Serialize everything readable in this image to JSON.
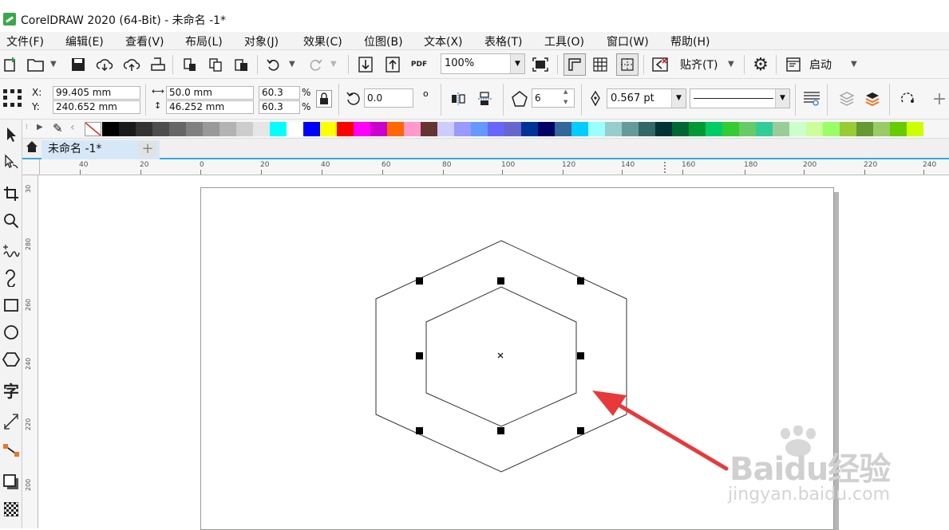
{
  "window": {
    "title": "CorelDRAW 2020 (64-Bit) - 未命名 -1*"
  },
  "menu": [
    "文件(F)",
    "编辑(E)",
    "查看(V)",
    "布局(L)",
    "对象(J)",
    "效果(C)",
    "位图(B)",
    "文本(X)",
    "表格(T)",
    "工具(O)",
    "窗口(W)",
    "帮助(H)"
  ],
  "toolbar": {
    "zoom": "100%",
    "pdf_label": "PDF",
    "snap_label": "贴齐(T)",
    "launch_label": "启动"
  },
  "props": {
    "x_label": "X:",
    "y_label": "Y:",
    "x_value": "99.405 mm",
    "y_value": "240.652 mm",
    "width_value": "50.0 mm",
    "height_value": "46.252 mm",
    "scale_x": "60.3",
    "scale_y": "60.3",
    "percent": "%",
    "rotation": "0.0",
    "degree": "o",
    "sides": "6",
    "outline_width": "0.567 pt"
  },
  "tabs": {
    "document": "未命名 -1*"
  },
  "ruler": {
    "h_ticks": [
      "40",
      "20",
      "0",
      "20",
      "40",
      "60",
      "80",
      "100",
      "120",
      "140",
      "160",
      "180",
      "200",
      "220",
      "240"
    ],
    "v_ticks": [
      "30",
      "280",
      "260",
      "240",
      "220",
      "200"
    ]
  },
  "palette": [
    "#000000",
    "#1a1a1a",
    "#333333",
    "#4d4d4d",
    "#666666",
    "#808080",
    "#999999",
    "#b3b3b3",
    "#cccccc",
    "#e6e6e6",
    "#00ffff",
    "#ffffff",
    "#0000ff",
    "#ffff00",
    "#ff0000",
    "#ff00ff",
    "#cc00cc",
    "#ff6600",
    "#ff99cc",
    "#663333",
    "#ccccff",
    "#9999ff",
    "#6699ff",
    "#6666ff",
    "#6666cc",
    "#003399",
    "#000066",
    "#336699",
    "#00ccff",
    "#99ffff",
    "#99cccc",
    "#669999",
    "#336666",
    "#003333",
    "#006633",
    "#009933",
    "#00cc66",
    "#33cc33",
    "#66cc66",
    "#33cc99",
    "#99cc99",
    "#ccffcc",
    "#ccff99",
    "#99ff66",
    "#99cc33",
    "#669933",
    "#99cc66",
    "#66cc00",
    "#ccff00"
  ],
  "watermark": {
    "brand": "Baidu经验",
    "url": "jingyan.baidu.com"
  }
}
